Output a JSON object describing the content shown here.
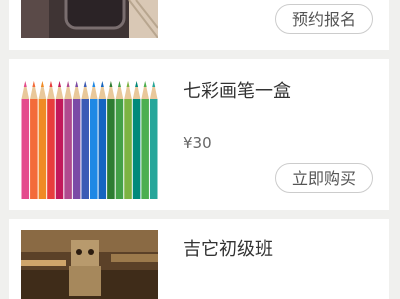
{
  "items": [
    {
      "title": "",
      "price": "",
      "button": "预约报名"
    },
    {
      "title": "七彩画笔一盒",
      "price": "¥30",
      "button": "立即购买"
    },
    {
      "title": "吉它初级班",
      "price": "",
      "button": ""
    }
  ],
  "colors": {
    "page_bg": "#f0f0ee",
    "card_bg": "#ffffff",
    "button_border": "#cccccc"
  },
  "icons": [
    "phone-image",
    "colored-pencils-image",
    "danbo-guitar-image"
  ]
}
